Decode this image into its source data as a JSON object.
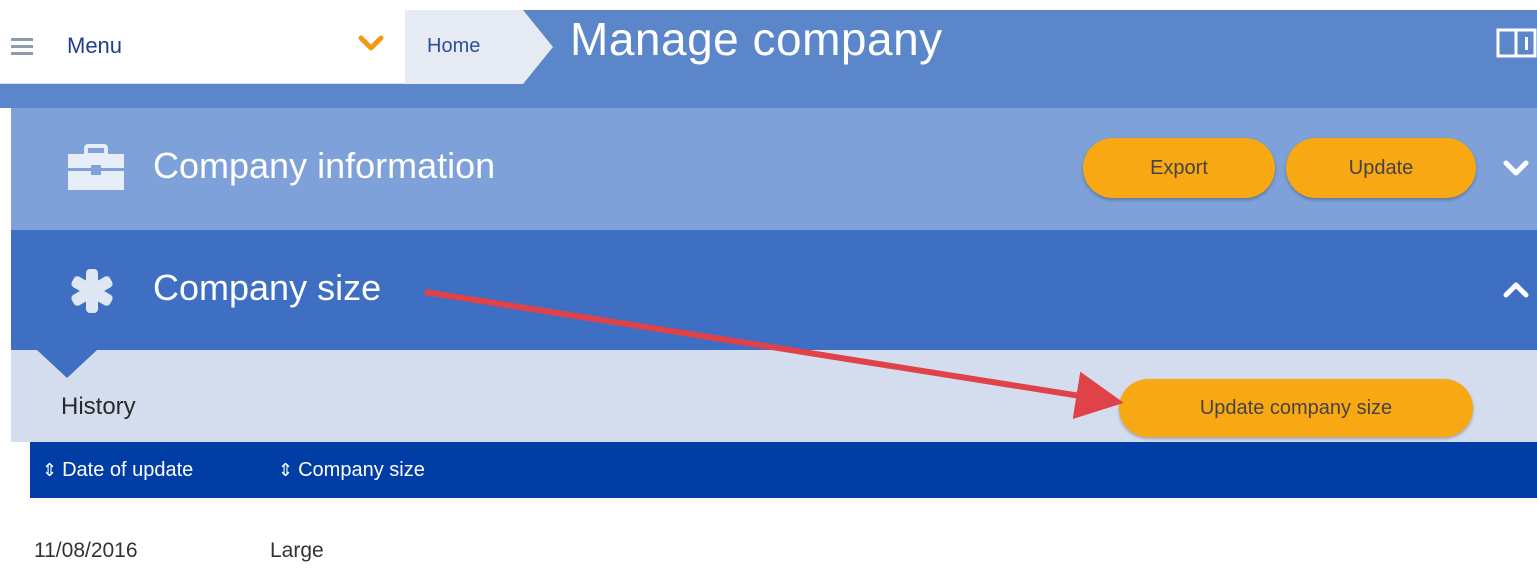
{
  "header": {
    "menu_label": "Menu",
    "breadcrumb_home": "Home",
    "page_title": "Manage company"
  },
  "sections": {
    "company_information": {
      "title": "Company information",
      "export_label": "Export",
      "update_label": "Update"
    },
    "company_size": {
      "title": "Company size"
    }
  },
  "history": {
    "label": "History",
    "update_button_label": "Update company size",
    "columns": [
      "Date of update",
      "Company size"
    ],
    "rows": [
      [
        "11/08/2016",
        "Large"
      ]
    ]
  },
  "colors": {
    "top_bar": "#5b86c9",
    "section_collapsed": "#7da1d8",
    "section_expanded": "#3e6fc3",
    "table_header": "#003da5",
    "accent_button": "#f8a813",
    "annotation_arrow": "#e0424a"
  }
}
